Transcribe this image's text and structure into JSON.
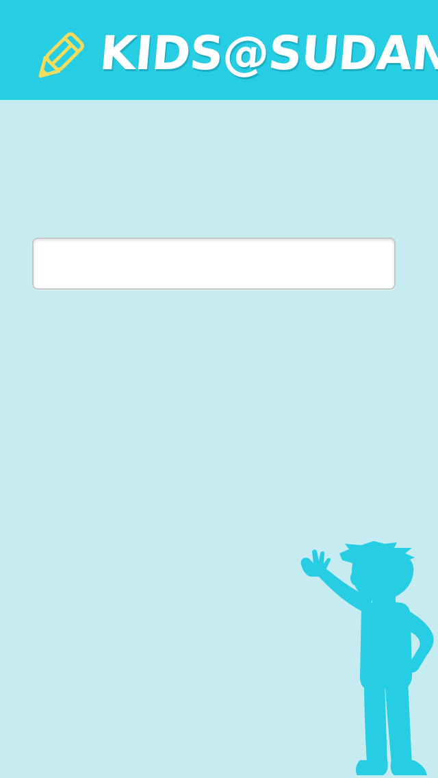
{
  "header": {
    "title": "KIDS@SUDAN",
    "logo_icon": "pencil-icon",
    "background_color": "#27cde2"
  },
  "main": {
    "background_color": "#c6ebf1",
    "text_field": {
      "value": "",
      "placeholder": ""
    }
  },
  "decoration": {
    "illustration": "waving-kid-silhouette",
    "color": "#27cde2"
  },
  "colors": {
    "pencil_outline": "#f2dc5d",
    "title_text": "#ffffff"
  }
}
